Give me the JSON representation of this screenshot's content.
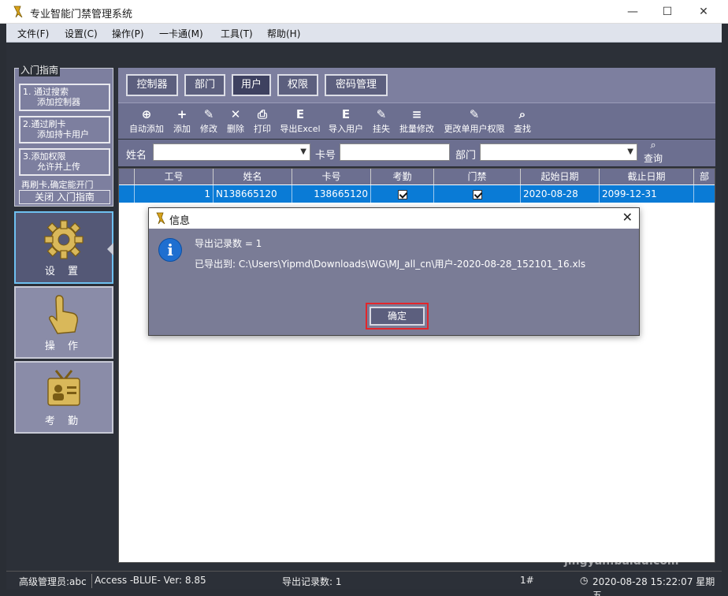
{
  "window": {
    "title": "专业智能门禁管理系统",
    "minimize": "—",
    "maximize": "☐",
    "close": "✕"
  },
  "menu": [
    "文件(F)",
    "设置(C)",
    "操作(P)",
    "一卡通(M)",
    "工具(T)",
    "帮助(H)"
  ],
  "guide": {
    "legend": "入门指南",
    "step1": {
      "line1": "1.  通过搜索",
      "line2": "添加控制器"
    },
    "step2": {
      "line1": "2.通过刷卡",
      "line2": "添加持卡用户"
    },
    "step3": {
      "line1": "3.添加权限",
      "line2": "允许并上传"
    },
    "note": "再刷卡,确定能开门",
    "close_label": "关闭 入门指南"
  },
  "sidebar": [
    {
      "label": "设 置",
      "icon": "gear-icon"
    },
    {
      "label": "操 作",
      "icon": "hand-pointer-icon"
    },
    {
      "label": "考 勤",
      "icon": "id-badge-icon"
    }
  ],
  "tabs": [
    "控制器",
    "部门",
    "用户",
    "权限",
    "密码管理"
  ],
  "toolbar": [
    {
      "label": "自动添加",
      "icon": "auto-add-icon",
      "glyph": "⊕"
    },
    {
      "label": "添加",
      "icon": "plus-icon",
      "glyph": "+"
    },
    {
      "label": "修改",
      "icon": "pencil-icon",
      "glyph": "✎"
    },
    {
      "label": "删除",
      "icon": "delete-x-icon",
      "glyph": "✕"
    },
    {
      "label": "打印",
      "icon": "printer-icon",
      "glyph": "⎙"
    },
    {
      "label": "导出Excel",
      "icon": "export-excel-icon",
      "glyph": "E"
    },
    {
      "label": "导入用户",
      "icon": "import-user-icon",
      "glyph": "E"
    },
    {
      "label": "挂失",
      "icon": "report-loss-icon",
      "glyph": "✎"
    },
    {
      "label": "批量修改",
      "icon": "batch-edit-icon",
      "glyph": "≡"
    },
    {
      "label": "更改单用户权限",
      "icon": "user-permission-icon",
      "glyph": "✎"
    },
    {
      "label": "查找",
      "icon": "search-icon",
      "glyph": "⌕"
    }
  ],
  "search": {
    "name_label": "姓名",
    "name_value": "",
    "card_label": "卡号",
    "card_value": "",
    "dept_label": "部门",
    "dept_value": "",
    "query_label": "查询"
  },
  "grid": {
    "headers": [
      "工号",
      "姓名",
      "卡号",
      "考勤",
      "门禁",
      "起始日期",
      "截止日期",
      "部"
    ],
    "rows": [
      {
        "id": "1",
        "name": "N138665120",
        "card": "138665120",
        "attendance": true,
        "access": true,
        "start": "2020-08-28",
        "end": "2099-12-31"
      }
    ]
  },
  "dialog": {
    "title": "信息",
    "line1": "导出记录数 = 1",
    "line2": "已导出到: C:\\Users\\Yipmd\\Downloads\\WG\\MJ_all_cn\\用户-2020-08-28_152101_16.xls",
    "ok_label": "确定"
  },
  "status": {
    "user": "高级管理员:abc",
    "version": "Access -BLUE- Ver: 8.85",
    "export_info": "导出记录数: 1",
    "port": "1#",
    "datetime": "2020-08-28 15:22:07 星期五"
  },
  "watermark": {
    "line1": "Baidu经验",
    "line2": "jingyan.baidu.com"
  }
}
